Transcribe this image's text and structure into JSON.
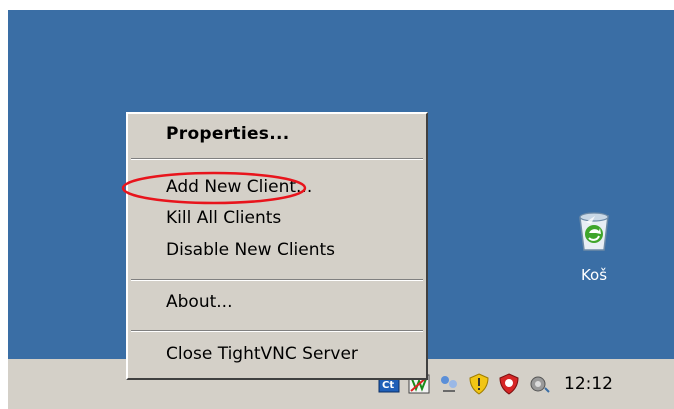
{
  "context_menu": {
    "items": [
      {
        "label": "Properties...",
        "default": true
      },
      {
        "label": "Add New Client...",
        "highlighted_with_circle": true
      },
      {
        "label": "Kill All Clients"
      },
      {
        "label": "Disable New Clients"
      },
      {
        "label": "About..."
      },
      {
        "label": "Close TightVNC Server"
      }
    ]
  },
  "desktop": {
    "background_color": "#3a6ea5",
    "icons": [
      {
        "label": "Koš",
        "icon": "recycle-bin-icon"
      }
    ]
  },
  "taskbar": {
    "tray_icons": [
      "tightvnc-icon",
      "vnc-viewer-icon",
      "network-icon",
      "security-shield-icon",
      "antivirus-icon",
      "volume-icon"
    ],
    "clock": "12:12"
  },
  "annotation_color": "#e8141c"
}
